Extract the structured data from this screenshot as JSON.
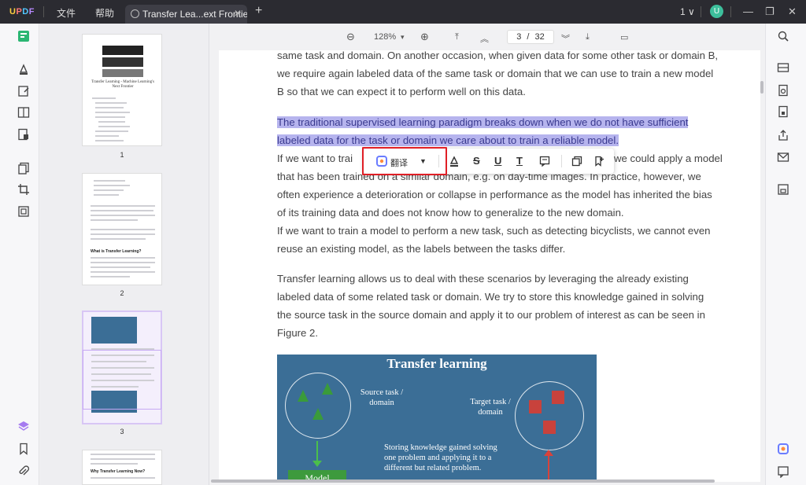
{
  "titlebar": {
    "logo": [
      "U",
      "P",
      "D",
      "F"
    ],
    "menu_file": "文件",
    "menu_help": "帮助",
    "tab_label": "Transfer Lea...ext Frontier",
    "tab_close": "✕",
    "new_tab": "+",
    "window_count": "1 ∨",
    "avatar_letter": "U",
    "minimize": "—",
    "restore": "❐",
    "close": "✕"
  },
  "viewer": {
    "zoom_out": "⊖",
    "zoom": "128%",
    "zoom_caret": "▾",
    "zoom_in": "⊕",
    "first_page": "⤒",
    "prev_page": "︽",
    "current_page": "3",
    "page_sep": "/",
    "total_pages": "32",
    "next_page": "︾",
    "last_page": "⤓",
    "present": "▭"
  },
  "thumbnails": [
    {
      "page": "1",
      "title": "Transfer Learning - Machine Learning's Next Frontier"
    },
    {
      "page": "2",
      "heading": "What is Transfer Learning?"
    },
    {
      "page": "3"
    },
    {
      "page": "",
      "heading": "Why Transfer Learning Now?"
    }
  ],
  "document": {
    "para1_lines": [
      "same task and domain. On another occasion, when given data for some other task or domain B,",
      "we require again labeled data of the same task or domain that we can use to train a new model",
      "B so that we can expect it to perform well on this data."
    ],
    "highlight_line1": "The traditional supervised learning paradigm breaks down when we do not have sufficient",
    "highlight_line2": "labeled data for the task or domain we care about to train a reliable model.",
    "para3_lines": [
      "If we want to train a model to perform a new task, we could apply a model",
      "that has been trained on a similar domain, e.g. on day-time images. In practice, however, we",
      "often experience a deterioration or collapse in performance as the model has inherited the bias",
      "of its training data and does not know how to generalize to the new domain.",
      "If we want to train a model to perform a new task, such as detecting bicyclists, we cannot even",
      "reuse an existing model, as the labels between the tasks differ."
    ],
    "para3_first_visible_start": "If we want to trai",
    "para3_first_visible_end": "we could apply a model",
    "para4_lines": [
      "Transfer learning allows us to deal with these scenarios by leveraging the already existing",
      "labeled data of some related task or domain. We try to store this knowledge gained in solving",
      "the source task in the source domain and apply it to our problem of interest as can be seen in",
      "Figure 2."
    ],
    "figure": {
      "title": "Transfer learning",
      "source_label": "Source task /\ndomain",
      "target_label": "Target task /\ndomain",
      "storing_text": "Storing knowledge gained solving\none problem and applying it to a\ndifferent but related problem.",
      "model_label": "Model"
    }
  },
  "floating_toolbar": {
    "translate_label": "翻译",
    "dropdown": "▼",
    "strike": "S",
    "underline": "U",
    "text_color": "T"
  }
}
